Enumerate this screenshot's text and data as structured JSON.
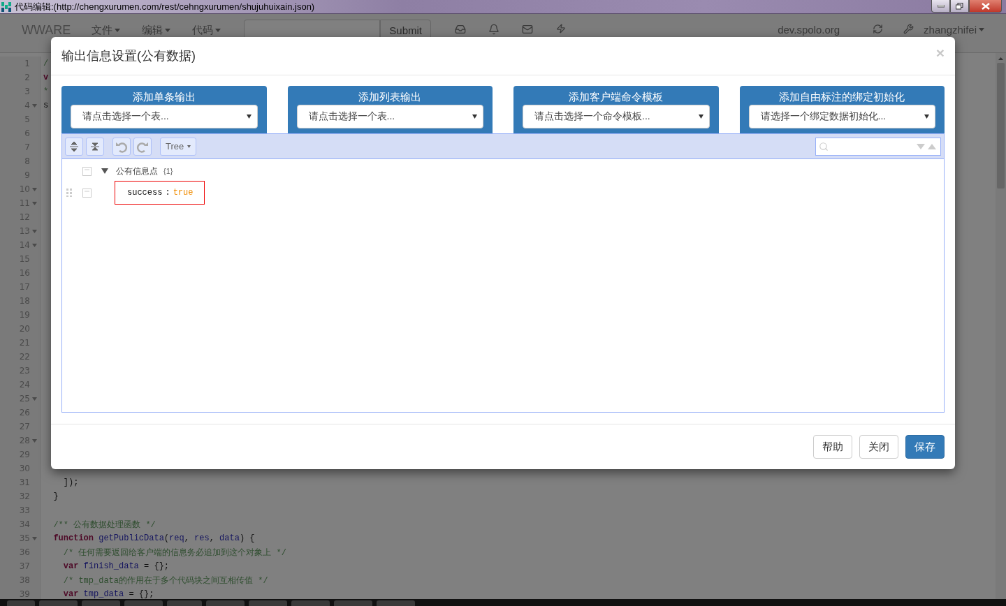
{
  "window": {
    "title": "代码编辑:(http://chengxurumen.com/rest/cehngxurumen/shujuhuixain.json)"
  },
  "navbar": {
    "brand": "WWARE",
    "menus": [
      {
        "label": "文件"
      },
      {
        "label": "编辑"
      },
      {
        "label": "代码"
      }
    ],
    "submit": "Submit",
    "host": "dev.spolo.org",
    "user": "zhangzhifei"
  },
  "editor": {
    "lines": [
      {
        "number": "1",
        "foldable": false,
        "tokens": [
          {
            "kind": "comment",
            "text": "/"
          }
        ]
      },
      {
        "number": "2",
        "foldable": false,
        "tokens": [
          {
            "kind": "keyword",
            "text": "v"
          }
        ]
      },
      {
        "number": "3",
        "foldable": false,
        "tokens": [
          {
            "kind": "comment",
            "text": "*"
          }
        ]
      },
      {
        "number": "4",
        "foldable": true,
        "tokens": [
          {
            "kind": "plain",
            "text": "s"
          }
        ]
      },
      {
        "number": "5",
        "foldable": false
      },
      {
        "number": "6",
        "foldable": false
      },
      {
        "number": "7",
        "foldable": false
      },
      {
        "number": "8",
        "foldable": false
      },
      {
        "number": "9",
        "foldable": false
      },
      {
        "number": "10",
        "foldable": true
      },
      {
        "number": "11",
        "foldable": true
      },
      {
        "number": "12",
        "foldable": false
      },
      {
        "number": "13",
        "foldable": true
      },
      {
        "number": "14",
        "foldable": true
      },
      {
        "number": "15",
        "foldable": false
      },
      {
        "number": "16",
        "foldable": false
      },
      {
        "number": "17",
        "foldable": false
      },
      {
        "number": "18",
        "foldable": false
      },
      {
        "number": "19",
        "foldable": false
      },
      {
        "number": "20",
        "foldable": false
      },
      {
        "number": "21",
        "foldable": false
      },
      {
        "number": "22",
        "foldable": false
      },
      {
        "number": "23",
        "foldable": false
      },
      {
        "number": "24",
        "foldable": false
      },
      {
        "number": "25",
        "foldable": true
      },
      {
        "number": "26",
        "foldable": false
      },
      {
        "number": "27",
        "foldable": false
      },
      {
        "number": "28",
        "foldable": true
      },
      {
        "number": "29",
        "foldable": false
      },
      {
        "number": "30",
        "foldable": false
      },
      {
        "number": "31",
        "foldable": false,
        "tokens": [
          {
            "kind": "plain",
            "text": "    ]);"
          }
        ]
      },
      {
        "number": "32",
        "foldable": false,
        "tokens": [
          {
            "kind": "plain",
            "text": "  }"
          }
        ]
      },
      {
        "number": "33",
        "foldable": false
      },
      {
        "number": "34",
        "foldable": false,
        "tokens": [
          {
            "kind": "comment",
            "text": "  /** 公有数据处理函数 */"
          }
        ]
      },
      {
        "number": "35",
        "foldable": true,
        "tokens": [
          {
            "kind": "keyword",
            "text": "  function "
          },
          {
            "kind": "variable",
            "text": "getPublicData"
          },
          {
            "kind": "plain",
            "text": "("
          },
          {
            "kind": "variable",
            "text": "req"
          },
          {
            "kind": "plain",
            "text": ", "
          },
          {
            "kind": "variable",
            "text": "res"
          },
          {
            "kind": "plain",
            "text": ", "
          },
          {
            "kind": "variable",
            "text": "data"
          },
          {
            "kind": "plain",
            "text": ") {"
          }
        ]
      },
      {
        "number": "36",
        "foldable": false,
        "tokens": [
          {
            "kind": "comment",
            "text": "    /* 任何需要返回给客户端的信息务必追加到这个对象上 */"
          }
        ]
      },
      {
        "number": "37",
        "foldable": false,
        "tokens": [
          {
            "kind": "keyword",
            "text": "    var "
          },
          {
            "kind": "variable",
            "text": "finish_data"
          },
          {
            "kind": "plain",
            "text": " = {};"
          }
        ]
      },
      {
        "number": "38",
        "foldable": false,
        "tokens": [
          {
            "kind": "comment",
            "text": "    /* tmp_data的作用在于多个代码块之间互相传值 */"
          }
        ]
      },
      {
        "number": "39",
        "foldable": false,
        "tokens": [
          {
            "kind": "keyword",
            "text": "    var "
          },
          {
            "kind": "variable",
            "text": "tmp_data"
          },
          {
            "kind": "plain",
            "text": " = {};"
          }
        ]
      }
    ]
  },
  "modal": {
    "title": "输出信息设置(公有数据)",
    "close": "×",
    "cards": [
      {
        "title": "添加单条输出",
        "placeholder": "请点击选择一个表..."
      },
      {
        "title": "添加列表输出",
        "placeholder": "请点击选择一个表..."
      },
      {
        "title": "添加客户端命令模板",
        "placeholder": "请点击选择一个命令模板..."
      },
      {
        "title": "添加自由标注的绑定初始化",
        "placeholder": "请选择一个绑定数据初始化..."
      }
    ],
    "json_editor": {
      "mode": "Tree",
      "root": {
        "key": "公有信息点",
        "count": "{1}",
        "expanded": true,
        "children": [
          {
            "key": "success",
            "separator": ":",
            "value": "true",
            "highlighted": true
          }
        ]
      }
    },
    "buttons": [
      {
        "label": "帮助",
        "primary": false
      },
      {
        "label": "关闭",
        "primary": false
      },
      {
        "label": "保存",
        "primary": true
      }
    ]
  }
}
